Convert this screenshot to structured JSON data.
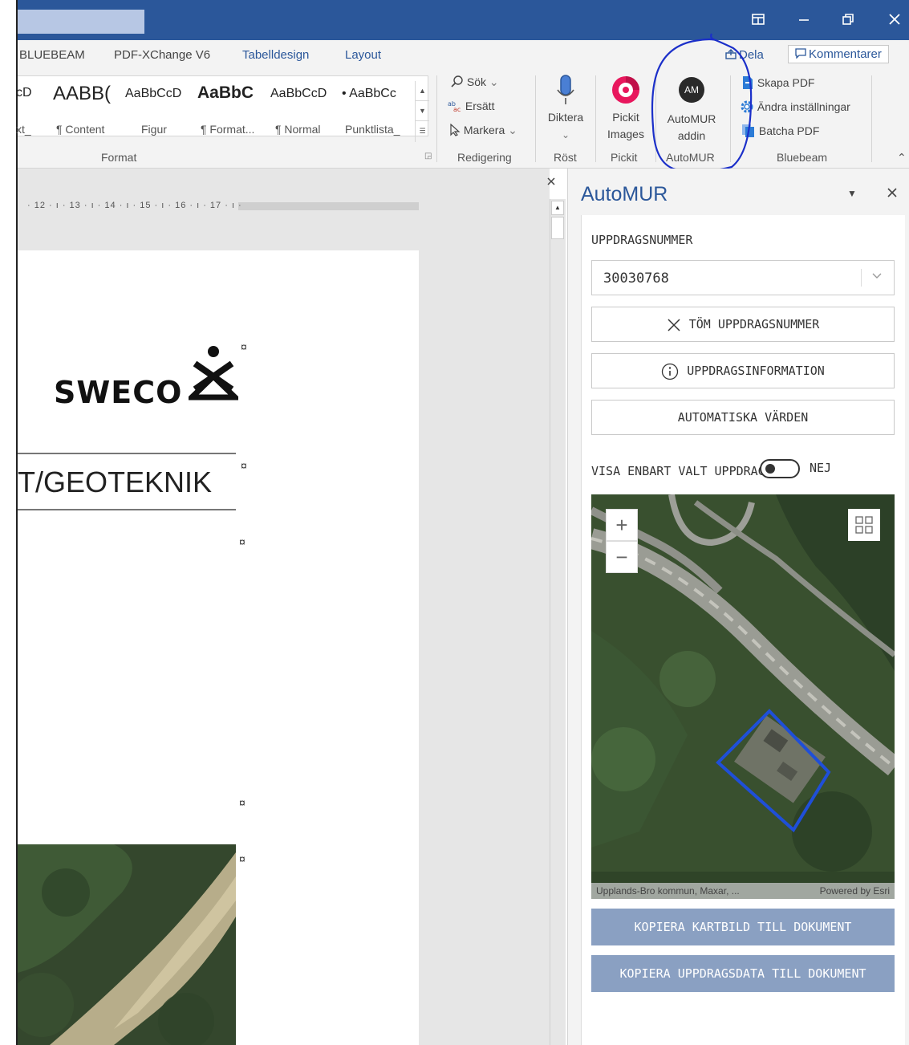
{
  "ribbon": {
    "tabs": [
      "BLUEBEAM",
      "PDF-XChange V6",
      "Tabelldesign",
      "Layout"
    ],
    "share_label": "Dela",
    "comments_label": "Kommentarer",
    "styles": [
      {
        "sample": "cD",
        "name": "xt_"
      },
      {
        "sample": "AABB(",
        "name": "¶ Content"
      },
      {
        "sample": "AaBbCcD",
        "name": "Figur"
      },
      {
        "sample": "AaBbC",
        "name": "¶ Format..."
      },
      {
        "sample": "AaBbCcD",
        "name": "¶ Normal"
      },
      {
        "sample": "• AaBbCc",
        "name": "Punktlista_"
      }
    ],
    "groups": {
      "format": "Format",
      "redigering": "Redigering",
      "rost": "Röst",
      "pickit": "Pickit",
      "automur": "AutoMUR",
      "bluebeam": "Bluebeam"
    },
    "editing": {
      "find": "Sök",
      "replace": "Ersätt",
      "select": "Markera"
    },
    "dictate": "Diktera",
    "pickit_label_1": "Pickit",
    "pickit_label_2": "Images",
    "automur_label_1": "AutoMUR",
    "automur_label_2": "addin",
    "automur_icon_text": "AM",
    "bluebeam": {
      "create": "Skapa PDF",
      "settings": "Ändra inställningar",
      "batch": "Batcha PDF"
    }
  },
  "document": {
    "ruler_text": "· 12 · ı · 13 · ı · 14 · ı · 15 · ı · 16 · ı · 17 · ı ·",
    "logo_text": "SWECO",
    "heading_text": "T/GEOTEKNIK",
    "anchor_symbol": "¤"
  },
  "pane": {
    "title": "AutoMUR",
    "assignment_label": "UPPDRAGSNUMMER",
    "assignment_value": "30030768",
    "clear_button": "TÖM UPPDRAGSNUMMER",
    "info_button": "UPPDRAGSINFORMATION",
    "auto_button": "AUTOMATISKA VÄRDEN",
    "toggle_label": "VISA ENBART VALT UPPDRAG",
    "toggle_value": "NEJ",
    "map_attribution_left": "Upplands-Bro kommun, Maxar, ...",
    "map_attribution_right": "Powered by Esri",
    "copy_map_button": "KOPIERA KARTBILD TILL DOKUMENT",
    "copy_data_button": "KOPIERA UPPDRAGSDATA TILL DOKUMENT"
  },
  "colors": {
    "title_bar": "#2b579a",
    "accent_blue": "#2b579a",
    "pane_action": "#8aa0c2"
  }
}
